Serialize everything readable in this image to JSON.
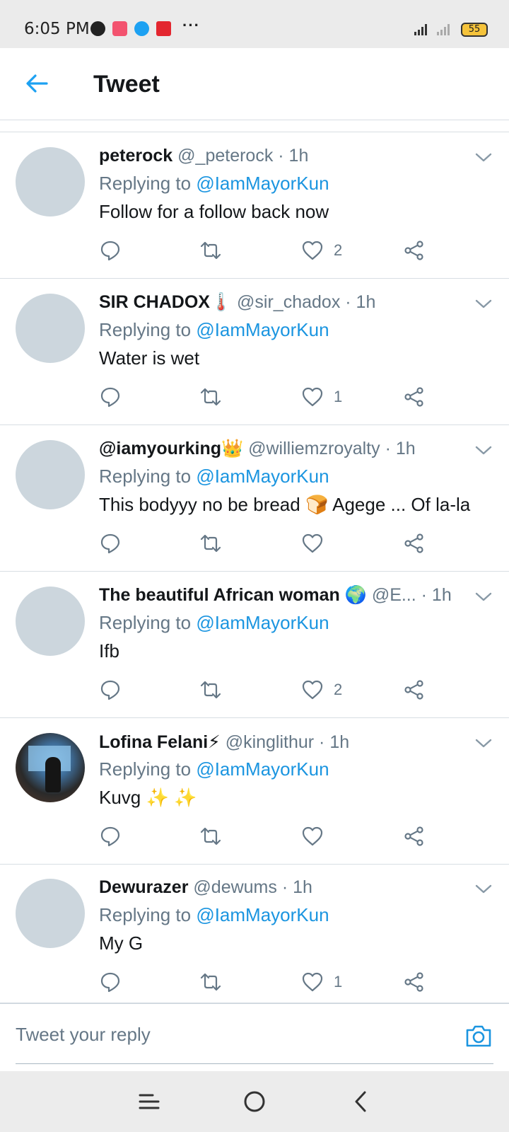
{
  "status_bar": {
    "time": "6:05 PM",
    "battery": "55",
    "more": "···"
  },
  "header": {
    "title": "Tweet"
  },
  "colors": {
    "accent": "#1b95e0",
    "muted": "#657786",
    "avatar_placeholder": "#ccd6dd"
  },
  "tweets": [
    {
      "name": "peterock",
      "handle": "@_peterock · 1h",
      "replying_prefix": "Replying to",
      "replying_to": "@IamMayorKun",
      "text": "Follow for a follow back now",
      "likes": "2"
    },
    {
      "name": "SIR CHADOX🌡️",
      "handle": "@sir_chadox · 1h",
      "replying_prefix": "Replying to",
      "replying_to": "@IamMayorKun",
      "text": "Water is wet",
      "likes": "1"
    },
    {
      "name": "@iamyourking👑",
      "handle": "@williemzroyalty · 1h",
      "replying_prefix": "Replying to",
      "replying_to": "@IamMayorKun",
      "text": "This bodyyy no be bread 🍞 Agege ... Of la-la",
      "likes": ""
    },
    {
      "name": "The beautiful African woman 🌍",
      "handle": "@E... · 1h",
      "replying_prefix": "Replying to",
      "replying_to": "@IamMayorKun",
      "text": "Ifb",
      "likes": "2"
    },
    {
      "name": "Lofina Felani⚡",
      "handle": "@kinglithur · 1h",
      "replying_prefix": "Replying to",
      "replying_to": "@IamMayorKun",
      "text": "Kuvg ✨ ✨",
      "likes": ""
    },
    {
      "name": "Dewurazer",
      "handle": "@dewums · 1h",
      "replying_prefix": "Replying to",
      "replying_to": "@IamMayorKun",
      "text": "My G",
      "likes": "1"
    }
  ],
  "reply_bar": {
    "placeholder": "Tweet your reply"
  }
}
